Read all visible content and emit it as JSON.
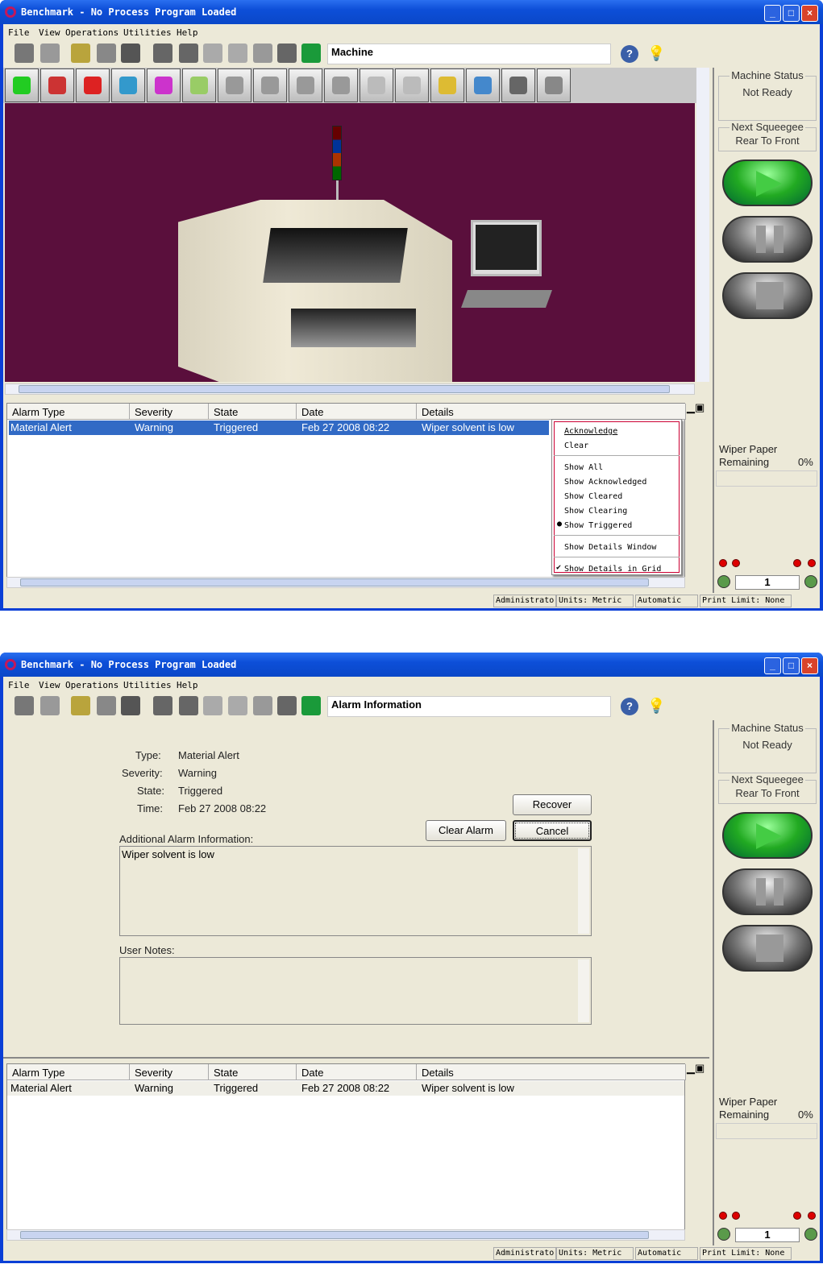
{
  "window": {
    "title": "Benchmark - No Process Program Loaded",
    "minimize": "_",
    "maximize": "□",
    "close": "×"
  },
  "menu": [
    "File",
    "View",
    "Operations",
    "Utilities",
    "Help"
  ],
  "toolbar": {
    "icons": [
      "monitor-icon",
      "back-icon",
      "open-folder-icon",
      "notepad-icon",
      "save-icon",
      "board-transfer-icon",
      "camera-icon",
      "load-board-icon",
      "unload-board-icon",
      "up-down-icon",
      "lift-icon",
      "lock-icon"
    ],
    "help": "?",
    "bulb": "💡"
  },
  "machine_view": {
    "address": "Machine",
    "big_icons": [
      "refresh-icon",
      "checklist-icon",
      "screwdriver-icon",
      "bar-chart-icon",
      "bar-chart-alt-icon",
      "rails-icon",
      "squeegee-icon",
      "blade-icon",
      "tool-icon",
      "stencil-icon",
      "board-icon",
      "wiper-icon",
      "transfer-icon",
      "solvent-drops-icon",
      "stencil-view-icon",
      "hook-icon"
    ],
    "bg_color": "#5a0f3c"
  },
  "alarm_view": {
    "address": "Alarm Information",
    "fields": [
      {
        "label": "Type:",
        "value": "Material Alert"
      },
      {
        "label": "Severity:",
        "value": "Warning"
      },
      {
        "label": "State:",
        "value": "Triggered"
      },
      {
        "label": "Time:",
        "value": "Feb 27 2008 08:22"
      }
    ],
    "recover": "Recover",
    "clear_alarm": "Clear Alarm",
    "cancel": "Cancel",
    "additional_label": "Additional Alarm Information:",
    "additional_text": "Wiper solvent is low",
    "notes_label": "User Notes:",
    "notes_text": ""
  },
  "grid": {
    "columns": [
      "Alarm Type",
      "Severity",
      "State",
      "Date",
      "Details"
    ],
    "rows": [
      [
        "Material Alert",
        "Warning",
        "Triggered",
        "Feb 27 2008 08:22",
        "Wiper solvent is low"
      ]
    ],
    "selection_color": "#316ac5"
  },
  "context_menu": {
    "items": [
      "Acknowledge",
      "Clear",
      "Show All",
      "Show Acknowledged",
      "Show Cleared",
      "Show Clearing",
      "Show Triggered",
      "Show Details Window",
      "Show Details in Grid"
    ],
    "radio_selected": "Show Triggered",
    "checked": "Show Details in Grid"
  },
  "right_panel": {
    "machine_status_label": "Machine Status",
    "machine_status": "Not Ready",
    "next_squeegee_label": "Next Squeegee",
    "next_squeegee": "Rear To Front",
    "wiper_label_1": "Wiper Paper",
    "wiper_label_2": "Remaining",
    "wiper_value": "0%",
    "counter": "1"
  },
  "status": {
    "user": "Administrator",
    "units": "Units: Metric",
    "mode": "Automatic",
    "print_limit": "Print Limit: None"
  }
}
